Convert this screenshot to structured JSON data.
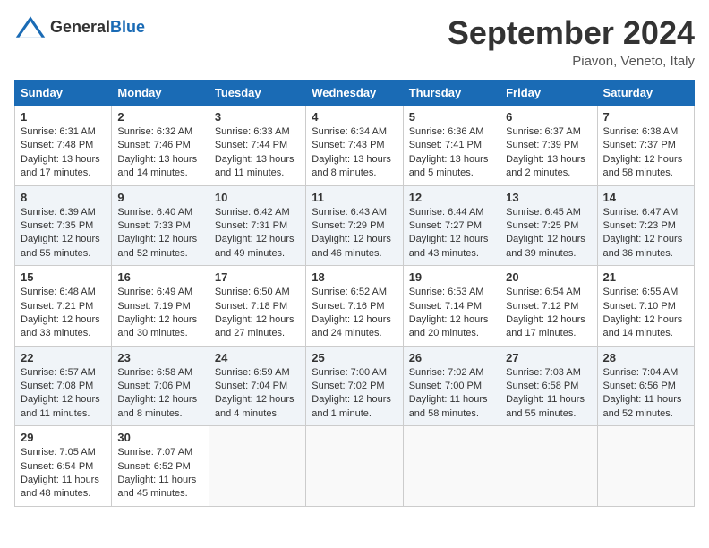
{
  "header": {
    "logo": {
      "general": "General",
      "blue": "Blue"
    },
    "title": "September 2024",
    "location": "Piavon, Veneto, Italy"
  },
  "weekdays": [
    "Sunday",
    "Monday",
    "Tuesday",
    "Wednesday",
    "Thursday",
    "Friday",
    "Saturday"
  ],
  "weeks": [
    [
      {
        "day": "1",
        "text": "Sunrise: 6:31 AM\nSunset: 7:48 PM\nDaylight: 13 hours and 17 minutes."
      },
      {
        "day": "2",
        "text": "Sunrise: 6:32 AM\nSunset: 7:46 PM\nDaylight: 13 hours and 14 minutes."
      },
      {
        "day": "3",
        "text": "Sunrise: 6:33 AM\nSunset: 7:44 PM\nDaylight: 13 hours and 11 minutes."
      },
      {
        "day": "4",
        "text": "Sunrise: 6:34 AM\nSunset: 7:43 PM\nDaylight: 13 hours and 8 minutes."
      },
      {
        "day": "5",
        "text": "Sunrise: 6:36 AM\nSunset: 7:41 PM\nDaylight: 13 hours and 5 minutes."
      },
      {
        "day": "6",
        "text": "Sunrise: 6:37 AM\nSunset: 7:39 PM\nDaylight: 13 hours and 2 minutes."
      },
      {
        "day": "7",
        "text": "Sunrise: 6:38 AM\nSunset: 7:37 PM\nDaylight: 12 hours and 58 minutes."
      }
    ],
    [
      {
        "day": "8",
        "text": "Sunrise: 6:39 AM\nSunset: 7:35 PM\nDaylight: 12 hours and 55 minutes."
      },
      {
        "day": "9",
        "text": "Sunrise: 6:40 AM\nSunset: 7:33 PM\nDaylight: 12 hours and 52 minutes."
      },
      {
        "day": "10",
        "text": "Sunrise: 6:42 AM\nSunset: 7:31 PM\nDaylight: 12 hours and 49 minutes."
      },
      {
        "day": "11",
        "text": "Sunrise: 6:43 AM\nSunset: 7:29 PM\nDaylight: 12 hours and 46 minutes."
      },
      {
        "day": "12",
        "text": "Sunrise: 6:44 AM\nSunset: 7:27 PM\nDaylight: 12 hours and 43 minutes."
      },
      {
        "day": "13",
        "text": "Sunrise: 6:45 AM\nSunset: 7:25 PM\nDaylight: 12 hours and 39 minutes."
      },
      {
        "day": "14",
        "text": "Sunrise: 6:47 AM\nSunset: 7:23 PM\nDaylight: 12 hours and 36 minutes."
      }
    ],
    [
      {
        "day": "15",
        "text": "Sunrise: 6:48 AM\nSunset: 7:21 PM\nDaylight: 12 hours and 33 minutes."
      },
      {
        "day": "16",
        "text": "Sunrise: 6:49 AM\nSunset: 7:19 PM\nDaylight: 12 hours and 30 minutes."
      },
      {
        "day": "17",
        "text": "Sunrise: 6:50 AM\nSunset: 7:18 PM\nDaylight: 12 hours and 27 minutes."
      },
      {
        "day": "18",
        "text": "Sunrise: 6:52 AM\nSunset: 7:16 PM\nDaylight: 12 hours and 24 minutes."
      },
      {
        "day": "19",
        "text": "Sunrise: 6:53 AM\nSunset: 7:14 PM\nDaylight: 12 hours and 20 minutes."
      },
      {
        "day": "20",
        "text": "Sunrise: 6:54 AM\nSunset: 7:12 PM\nDaylight: 12 hours and 17 minutes."
      },
      {
        "day": "21",
        "text": "Sunrise: 6:55 AM\nSunset: 7:10 PM\nDaylight: 12 hours and 14 minutes."
      }
    ],
    [
      {
        "day": "22",
        "text": "Sunrise: 6:57 AM\nSunset: 7:08 PM\nDaylight: 12 hours and 11 minutes."
      },
      {
        "day": "23",
        "text": "Sunrise: 6:58 AM\nSunset: 7:06 PM\nDaylight: 12 hours and 8 minutes."
      },
      {
        "day": "24",
        "text": "Sunrise: 6:59 AM\nSunset: 7:04 PM\nDaylight: 12 hours and 4 minutes."
      },
      {
        "day": "25",
        "text": "Sunrise: 7:00 AM\nSunset: 7:02 PM\nDaylight: 12 hours and 1 minute."
      },
      {
        "day": "26",
        "text": "Sunrise: 7:02 AM\nSunset: 7:00 PM\nDaylight: 11 hours and 58 minutes."
      },
      {
        "day": "27",
        "text": "Sunrise: 7:03 AM\nSunset: 6:58 PM\nDaylight: 11 hours and 55 minutes."
      },
      {
        "day": "28",
        "text": "Sunrise: 7:04 AM\nSunset: 6:56 PM\nDaylight: 11 hours and 52 minutes."
      }
    ],
    [
      {
        "day": "29",
        "text": "Sunrise: 7:05 AM\nSunset: 6:54 PM\nDaylight: 11 hours and 48 minutes."
      },
      {
        "day": "30",
        "text": "Sunrise: 7:07 AM\nSunset: 6:52 PM\nDaylight: 11 hours and 45 minutes."
      },
      {
        "day": "",
        "text": ""
      },
      {
        "day": "",
        "text": ""
      },
      {
        "day": "",
        "text": ""
      },
      {
        "day": "",
        "text": ""
      },
      {
        "day": "",
        "text": ""
      }
    ]
  ]
}
